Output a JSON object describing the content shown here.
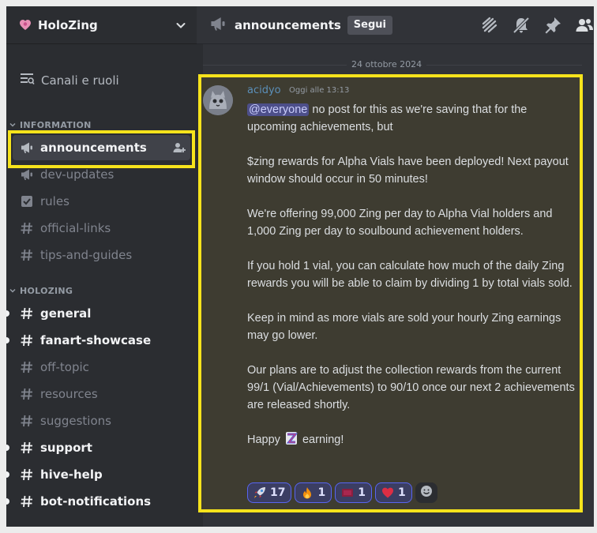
{
  "server": {
    "name": "HoloZing",
    "icon": "heart-shield-icon",
    "chevron": "chevron-down-icon"
  },
  "sidebar": {
    "channels_roles": "Canali e ruoli",
    "categories": [
      {
        "label": "INFORMATION",
        "channels": [
          {
            "label": "announcements",
            "icon": "megaphone-icon",
            "state": "active"
          },
          {
            "label": "dev-updates",
            "icon": "megaphone-icon",
            "state": "muted"
          },
          {
            "label": "rules",
            "icon": "checkbox-icon",
            "state": "muted"
          },
          {
            "label": "official-links",
            "icon": "hash-icon",
            "state": "muted"
          },
          {
            "label": "tips-and-guides",
            "icon": "hash-icon",
            "state": "muted"
          }
        ]
      },
      {
        "label": "HOLOZING",
        "channels": [
          {
            "label": "general",
            "icon": "hash-icon",
            "state": "unread"
          },
          {
            "label": "fanart-showcase",
            "icon": "hash-icon",
            "state": "unread"
          },
          {
            "label": "off-topic",
            "icon": "hash-icon",
            "state": "muted"
          },
          {
            "label": "resources",
            "icon": "hash-icon",
            "state": "muted"
          },
          {
            "label": "suggestions",
            "icon": "hash-icon",
            "state": "muted"
          },
          {
            "label": "support",
            "icon": "hash-icon",
            "state": "unread"
          },
          {
            "label": "hive-help",
            "icon": "hash-icon",
            "state": "unread"
          },
          {
            "label": "bot-notifications",
            "icon": "hash-icon",
            "state": "unread"
          }
        ]
      }
    ]
  },
  "topbar": {
    "title": "announcements",
    "follow_label": "Segui",
    "icons": [
      "threads-icon",
      "mute-bell-icon",
      "pin-icon",
      "members-icon"
    ]
  },
  "date_divider": "24 ottobre 2024",
  "message": {
    "author": "acidyo",
    "timestamp": "Oggi alle 13:13",
    "mention": "@everyone",
    "line1_rest": " no post for this as we're saving that for the upcoming achievements, but",
    "p2": "$zing rewards for Alpha Vials have been deployed! Next payout window should occur in 50 minutes!",
    "p3": "We're offering 99,000 Zing per day to Alpha Vial holders and 1,000 Zing per day to soulbound achievement holders.",
    "p4": "If you hold 1 vial, you can calculate how much of the daily Zing rewards you will be able to claim by dividing 1 by total vials sold.",
    "p5": "Keep in mind as more vials are sold your hourly Zing earnings may go lower.",
    "p6": "Our plans are to adjust the collection rewards from the current 99/1 (Vial/Achievements) to 90/10 once our next 2 achievements are released shortly.",
    "p7_a": "Happy",
    "p7_b": "earning!"
  },
  "reactions": [
    {
      "emoji": "rocket-icon",
      "count": "17"
    },
    {
      "emoji": "fire-icon",
      "count": "1"
    },
    {
      "emoji": "flag-icon",
      "count": "1"
    },
    {
      "emoji": "heart-icon",
      "count": "1"
    }
  ],
  "add_reaction_icon": "smiley-add-icon",
  "colors": {
    "highlight": "#f6e31c",
    "sidebar": "#2b2d31",
    "main": "#313338",
    "accent": "#5865f2"
  }
}
